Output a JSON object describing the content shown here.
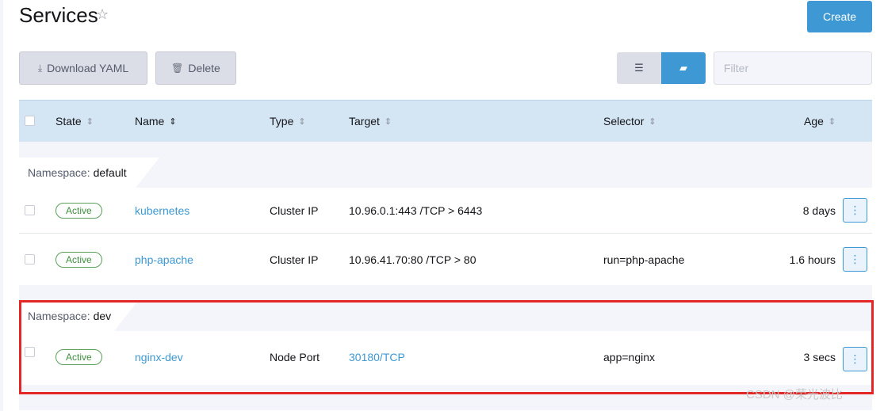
{
  "header": {
    "title": "Services",
    "create_label": "Create"
  },
  "toolbar": {
    "download_label": "Download YAML",
    "delete_label": "Delete",
    "filter_placeholder": "Filter"
  },
  "icons": {
    "star": "star-outline-icon",
    "download": "download-icon",
    "trash": "trash-icon",
    "list": "list-icon",
    "folder": "folder-icon",
    "sort": "sort-icon",
    "kebab": "kebab-menu-icon"
  },
  "colors": {
    "accent": "#3d98d3",
    "active_badge": "#3f8f3f",
    "highlight": "#e32626",
    "table_header": "#d4e6f4"
  },
  "table": {
    "columns": [
      "State",
      "Name",
      "Type",
      "Target",
      "Selector",
      "Age"
    ],
    "groups": [
      {
        "prefix": "Namespace:",
        "name": "default",
        "rows": [
          {
            "state": "Active",
            "name": "kubernetes",
            "type": "Cluster IP",
            "target": "10.96.0.1:443 /TCP > 6443",
            "selector": "",
            "age": "8 days"
          },
          {
            "state": "Active",
            "name": "php-apache",
            "type": "Cluster IP",
            "target": "10.96.41.70:80 /TCP > 80",
            "selector": "run=php-apache",
            "age": "1.6 hours"
          }
        ]
      },
      {
        "prefix": "Namespace:",
        "name": "dev",
        "rows": [
          {
            "state": "Active",
            "name": "nginx-dev",
            "type": "Node Port",
            "target": "30180/TCP",
            "selector": "app=nginx",
            "age": "3 secs"
          }
        ]
      }
    ]
  },
  "watermark": "CSDN @荣光波比"
}
